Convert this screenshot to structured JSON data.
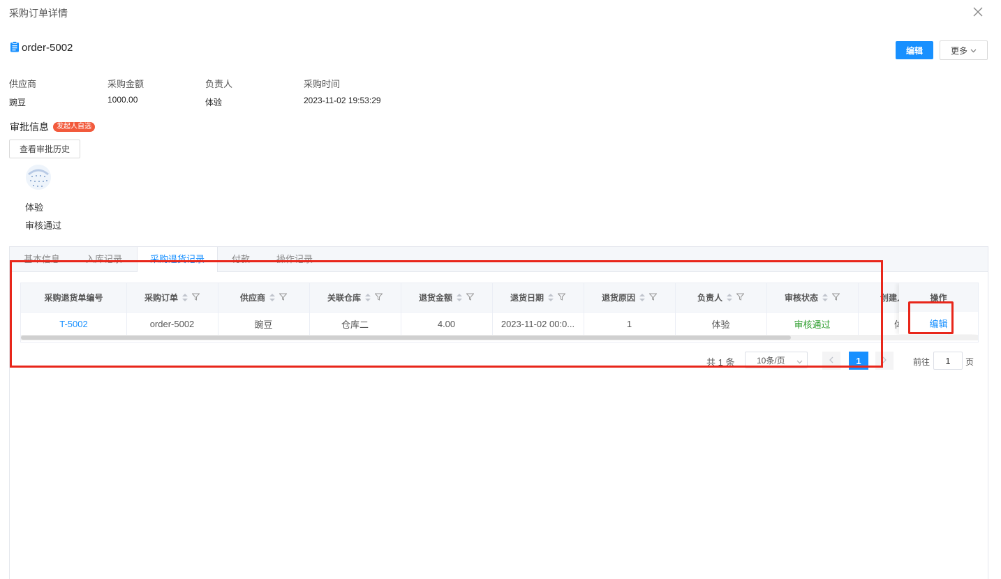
{
  "dialog": {
    "title": "采购订单详情"
  },
  "order": {
    "title": "order-5002"
  },
  "actions": {
    "edit_label": "编辑",
    "more_label": "更多"
  },
  "info": [
    {
      "label": "供应商",
      "value": "豌豆"
    },
    {
      "label": "采购金额",
      "value": "1000.00"
    },
    {
      "label": "负责人",
      "value": "体验"
    },
    {
      "label": "采购时间",
      "value": "2023-11-02 19:53:29"
    }
  ],
  "approval": {
    "title": "审批信息",
    "tag": "发起人自选",
    "history_button": "查看审批历史",
    "approver_name": "体验",
    "approver_status": "审核通过"
  },
  "tabs": [
    {
      "label": "基本信息",
      "active": false
    },
    {
      "label": "入库记录",
      "active": false
    },
    {
      "label": "采购退货记录",
      "active": true
    },
    {
      "label": "付款",
      "active": false
    },
    {
      "label": "操作记录",
      "active": false
    }
  ],
  "table": {
    "columns": [
      "采购退货单编号",
      "采购订单",
      "供应商",
      "关联仓库",
      "退货金额",
      "退货日期",
      "退货原因",
      "负责人",
      "审核状态",
      "创建人",
      "操作"
    ],
    "rows": [
      {
        "return_no": "T-5002",
        "order": "order-5002",
        "supplier": "豌豆",
        "warehouse": "仓库二",
        "amount": "4.00",
        "date": "2023-11-02 00:0...",
        "reason": "1",
        "owner": "体验",
        "status": "审核通过",
        "creator": "体",
        "action": "编辑"
      }
    ]
  },
  "pagination": {
    "total": "共 1 条",
    "page_size": "10条/页",
    "current_page": "1",
    "goto_label": "前往",
    "goto_value": "1",
    "goto_suffix": "页"
  },
  "colors": {
    "primary": "#1890ff",
    "highlight": "#e8261a",
    "success": "#2e9e2e",
    "tag": "#f25a3c"
  }
}
